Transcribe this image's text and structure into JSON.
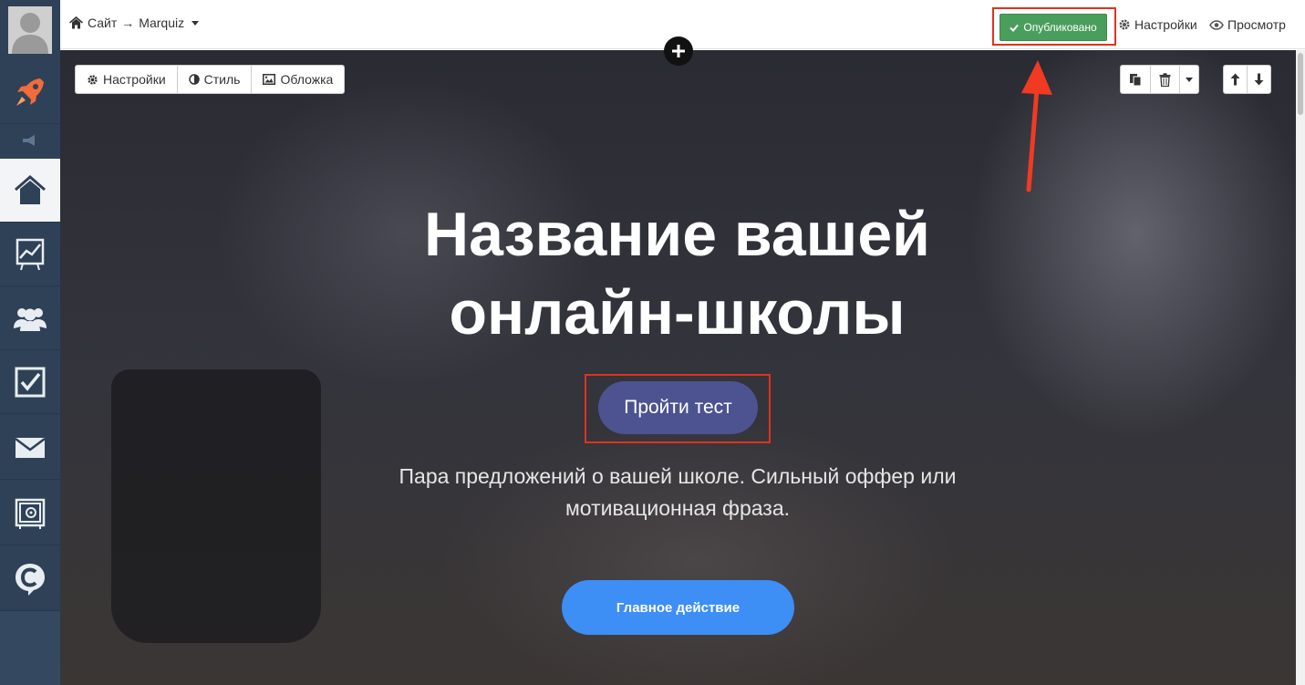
{
  "topbar": {
    "breadcrumb_site": "Сайт",
    "breadcrumb_arrow": "→",
    "breadcrumb_project": "Marquiz",
    "published_label": "Опубликовано",
    "settings_label": "Настройки",
    "preview_label": "Просмотр"
  },
  "sidebar": {
    "items": [
      {
        "icon": "rocket-icon"
      },
      {
        "icon": "megaphone-icon"
      },
      {
        "icon": "home-icon",
        "active": true
      },
      {
        "icon": "chart-icon"
      },
      {
        "icon": "users-icon"
      },
      {
        "icon": "checkbox-icon"
      },
      {
        "icon": "mail-icon"
      },
      {
        "icon": "safe-icon"
      },
      {
        "icon": "chat-c-icon"
      }
    ]
  },
  "block_toolbar": {
    "settings_label": "Настройки",
    "style_label": "Стиль",
    "cover_label": "Обложка"
  },
  "hero": {
    "title_line1": "Название вашей",
    "title_line2": "онлайн-школы",
    "cta_label": "Пройти тест",
    "subtitle_line1": "Пара предложений о вашей школе. Сильный оффер или",
    "subtitle_line2": "мотивационная фраза.",
    "main_action_label": "Главное действие"
  },
  "colors": {
    "sidebar_bg": "#2e4157",
    "published_green": "#4a9e5c",
    "highlight_red": "#e0321f",
    "cta_purple": "#4d5391",
    "main_action_blue": "#3d8ef5"
  }
}
